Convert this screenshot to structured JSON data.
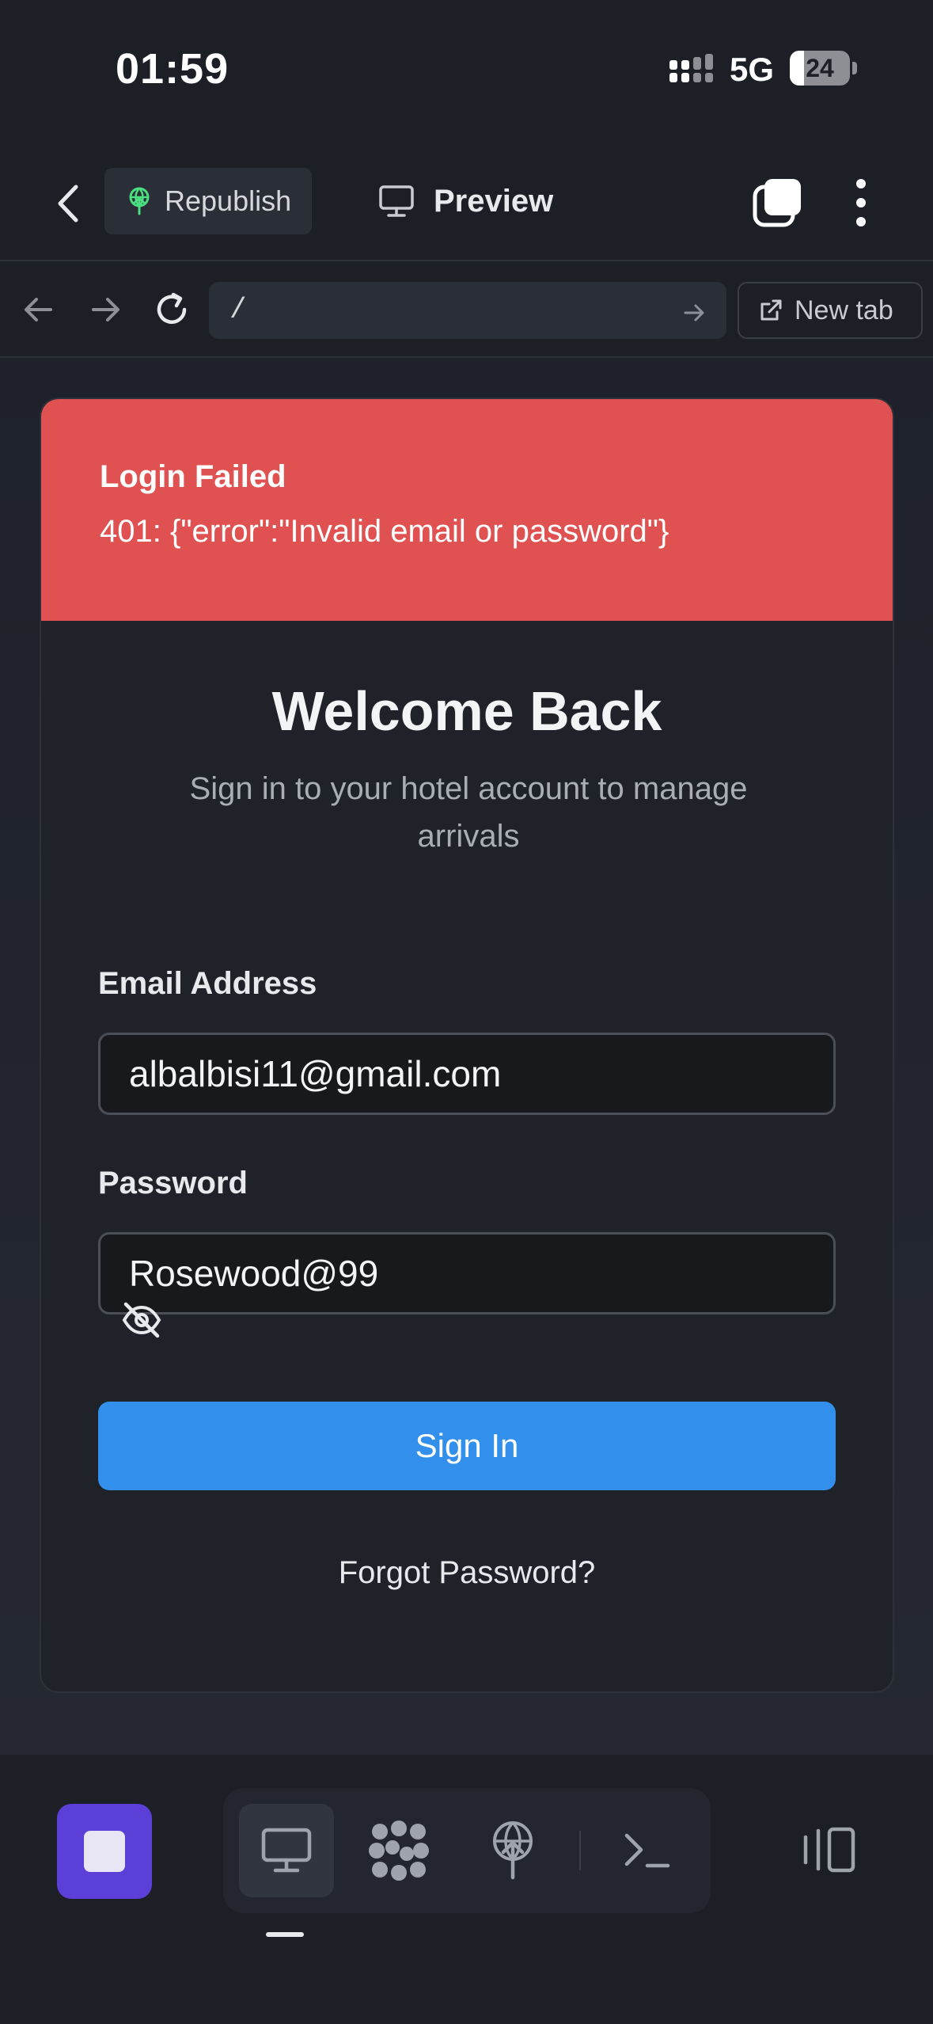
{
  "status_bar": {
    "time": "01:59",
    "network": "5G",
    "battery": "24",
    "battery_level": 0.24
  },
  "app_bar": {
    "back_icon": "chevron-left-icon",
    "republish_label": "Republish",
    "preview_label": "Preview"
  },
  "browser": {
    "url": "/",
    "new_tab_label": "New tab"
  },
  "alert": {
    "title": "Login Failed",
    "message": "401: {\"error\":\"Invalid email or password\"}",
    "color": "#e05252"
  },
  "login": {
    "title": "Welcome Back",
    "subtitle": "Sign in to your hotel account to manage arrivals",
    "email_label": "Email Address",
    "email_value": "albalbisi11@gmail.com",
    "password_label": "Password",
    "password_value": "Rosewood@99",
    "signin_label": "Sign In",
    "forgot_label": "Forgot Password?",
    "accent": "#3290ec"
  },
  "bottom_bar": {
    "tools": [
      "desktop-icon",
      "apps-grid-icon",
      "deploy-icon",
      "terminal-icon"
    ],
    "active_tool": "desktop-icon"
  }
}
